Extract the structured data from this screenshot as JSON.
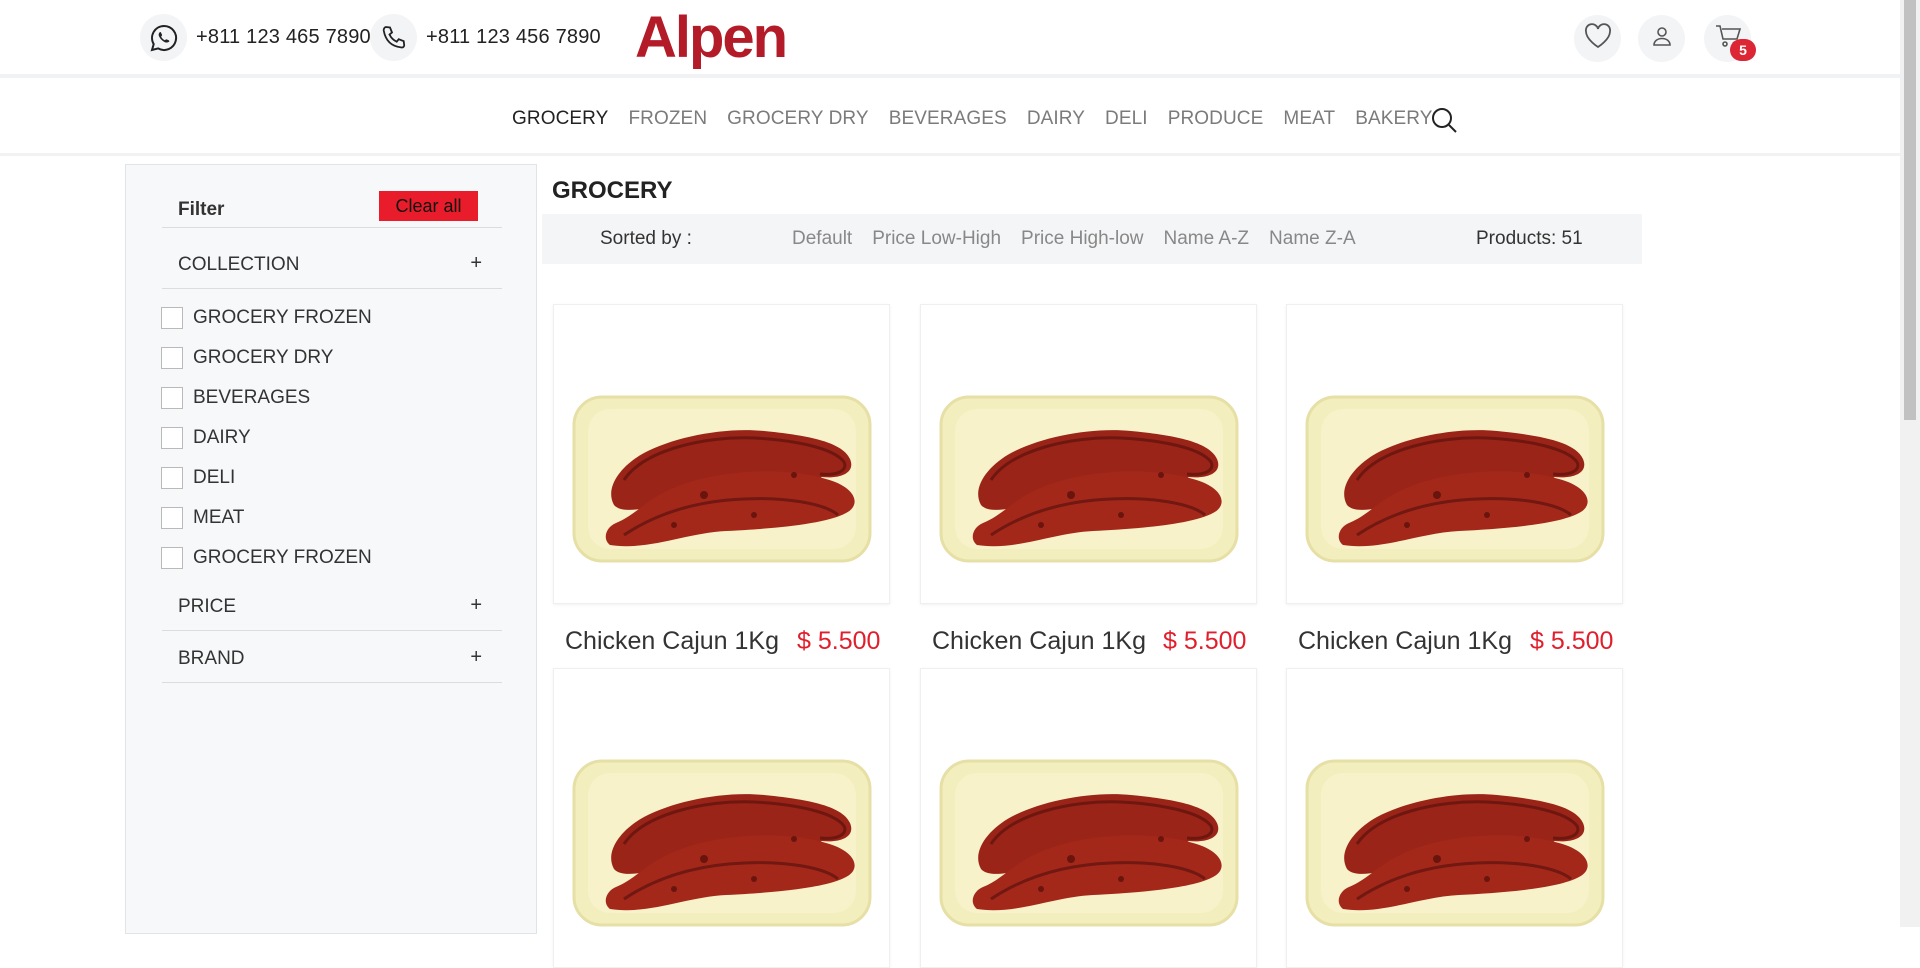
{
  "header": {
    "whatsapp_number": "+811 123 465 7890",
    "phone_number": "+811 123 456 7890",
    "logo_text": "Alpen",
    "cart_count": "5"
  },
  "nav": {
    "items": [
      "GROCERY",
      "FROZEN",
      "GROCERY DRY",
      "BEVERAGES",
      "DAIRY",
      "DELI",
      "PRODUCE",
      "MEAT",
      "BAKERY"
    ],
    "active": "GROCERY"
  },
  "sidebar": {
    "filter_title": "Filter",
    "clear_label": "Clear all",
    "collection_label": "COLLECTION",
    "collection_options": [
      "GROCERY FROZEN",
      "GROCERY DRY",
      "BEVERAGES",
      "DAIRY",
      "DELI",
      "MEAT",
      "GROCERY FROZEN"
    ],
    "price_label": "PRICE",
    "brand_label": "BRAND",
    "expand_symbol": "+"
  },
  "main": {
    "category_title": "GROCERY",
    "sorted_by_label": "Sorted by :",
    "sort_options": [
      "Default",
      "Price Low-High",
      "Price High-low",
      "Name A-Z",
      "Name Z-A"
    ],
    "products_count": "Products: 51"
  },
  "products": [
    {
      "name": "Chicken Cajun 1Kg",
      "price": "$ 5.500"
    },
    {
      "name": "Chicken Cajun 1Kg",
      "price": "$ 5.500"
    },
    {
      "name": "Chicken Cajun 1Kg",
      "price": "$ 5.500"
    },
    {
      "name": "",
      "price": ""
    },
    {
      "name": "",
      "price": ""
    },
    {
      "name": "",
      "price": ""
    }
  ],
  "colors": {
    "brand": "#b31b28",
    "price": "#e01e2c",
    "clear_button": "#e81c2a",
    "badge": "#dc2535"
  }
}
